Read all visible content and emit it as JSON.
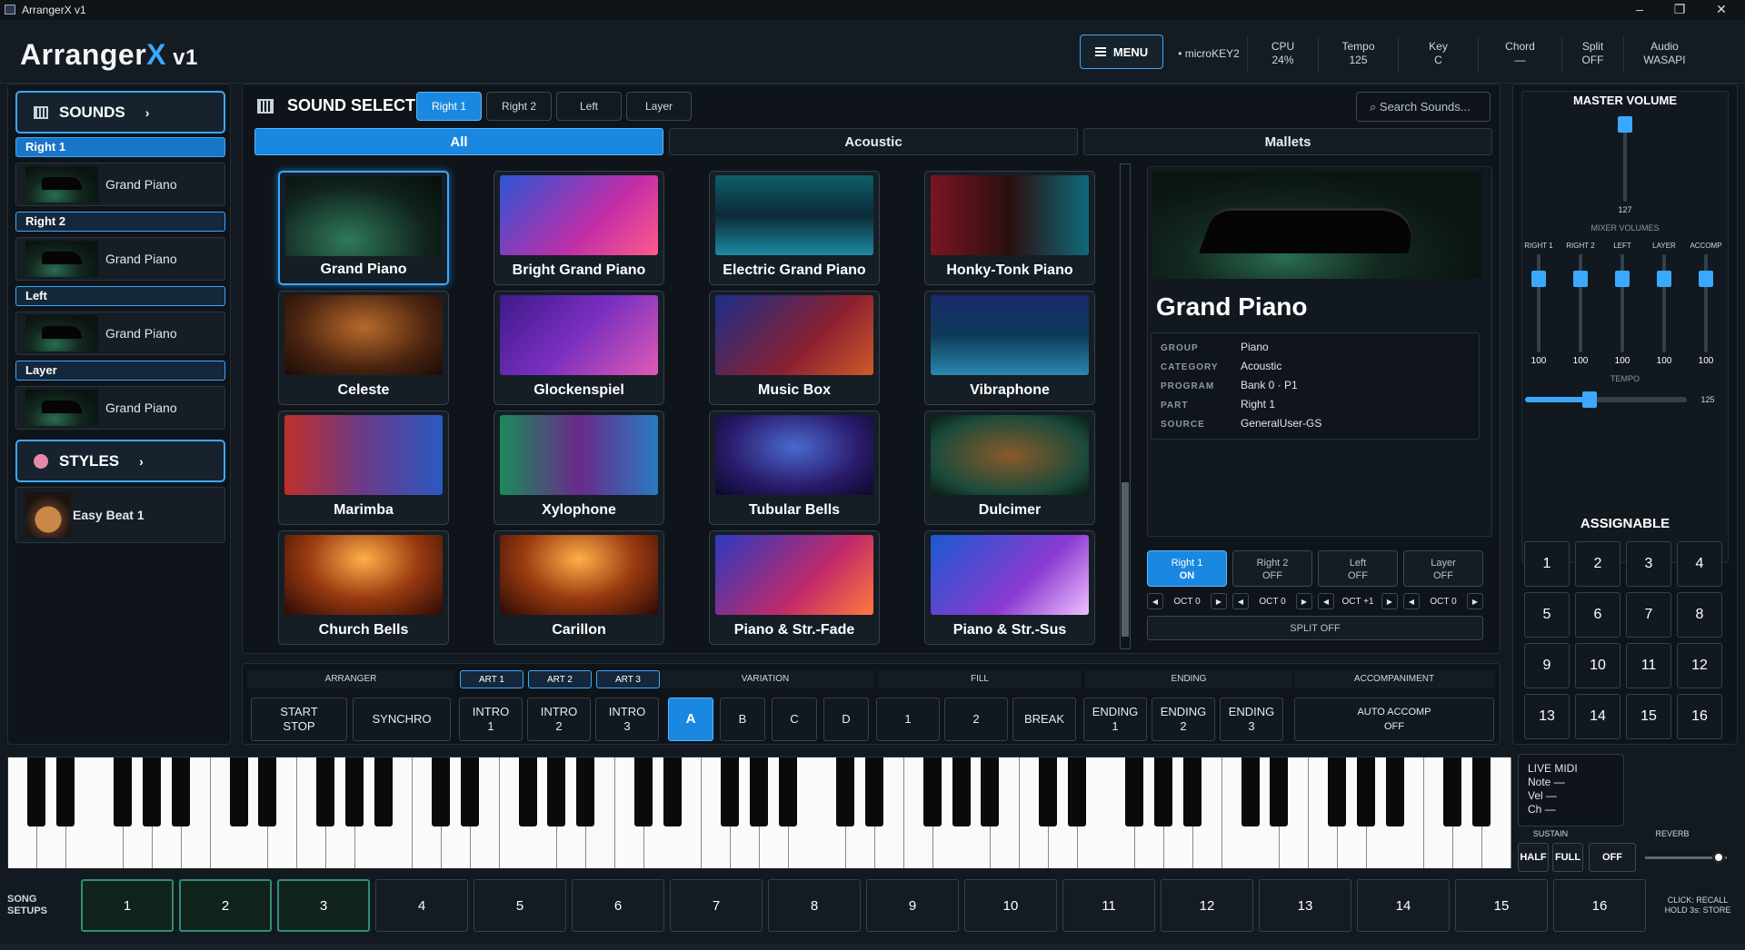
{
  "window": {
    "title": "ArrangerX v1",
    "minimize": "–",
    "maximize": "❐",
    "close": "✕"
  },
  "app": {
    "logo_main": "Arranger",
    "logo_x": "X",
    "logo_ver": " v1",
    "menu_label": "MENU"
  },
  "status": [
    {
      "top": "",
      "bottom": "• microKEY2"
    },
    {
      "top": "CPU",
      "bottom": "24%"
    },
    {
      "top": "Tempo",
      "bottom": "125"
    },
    {
      "top": "Key",
      "bottom": "C"
    },
    {
      "top": "Chord",
      "bottom": "—"
    },
    {
      "top": "Split",
      "bottom": "OFF"
    },
    {
      "top": "Audio",
      "bottom": "WASAPI"
    }
  ],
  "sidebar": {
    "sounds_label": "SOUNDS",
    "styles_label": "STYLES",
    "arrow": "›",
    "parts": [
      {
        "label": "Right 1",
        "sound": "Grand Piano"
      },
      {
        "label": "Right 2",
        "sound": "Grand Piano"
      },
      {
        "label": "Left",
        "sound": "Grand Piano"
      },
      {
        "label": "Layer",
        "sound": "Grand Piano"
      }
    ],
    "style": "Easy Beat 1"
  },
  "sound_select": {
    "title": "SOUND SELECT",
    "part_tabs": [
      "Right 1",
      "Right 2",
      "Left",
      "Layer"
    ],
    "search_placeholder": "⌕  Search Sounds...",
    "filters": [
      "All",
      "Acoustic",
      "Mallets"
    ],
    "tiles": [
      "Grand Piano",
      "Bright Grand Piano",
      "Electric Grand Piano",
      "Honky-Tonk Piano",
      "Celeste",
      "Glockenspiel",
      "Music Box",
      "Vibraphone",
      "Marimba",
      "Xylophone",
      "Tubular Bells",
      "Dulcimer",
      "Church Bells",
      "Carillon",
      "Piano & Str.-Fade",
      "Piano & Str.-Sus"
    ]
  },
  "detail": {
    "name": "Grand Piano",
    "rows": [
      {
        "k": "GROUP",
        "v": "Piano"
      },
      {
        "k": "CATEGORY",
        "v": "Acoustic"
      },
      {
        "k": "PROGRAM",
        "v": "Bank 0 · P1"
      },
      {
        "k": "PART",
        "v": "Right 1"
      },
      {
        "k": "SOURCE",
        "v": "GeneralUser-GS"
      }
    ],
    "parts": [
      {
        "name": "Right 1",
        "state": "ON",
        "oct": "OCT 0"
      },
      {
        "name": "Right 2",
        "state": "OFF",
        "oct": "OCT 0"
      },
      {
        "name": "Left",
        "state": "OFF",
        "oct": "OCT +1"
      },
      {
        "name": "Layer",
        "state": "OFF",
        "oct": "OCT 0"
      }
    ],
    "split": "SPLIT OFF"
  },
  "arranger": {
    "sections": [
      "ARRANGER",
      "VARIATION",
      "FILL",
      "ENDING",
      "ACCOMPANIMENT"
    ],
    "arts": [
      "ART 1",
      "ART 2",
      "ART 3"
    ],
    "start_stop": "START\nSTOP",
    "synchro": "SYNCHRO",
    "intros": [
      "INTRO\n1",
      "INTRO\n2",
      "INTRO\n3"
    ],
    "variations": [
      "A",
      "B",
      "C",
      "D"
    ],
    "fills": [
      "1",
      "2",
      "BREAK"
    ],
    "endings": [
      "ENDING\n1",
      "ENDING\n2",
      "ENDING\n3"
    ],
    "auto": "AUTO ACCOMP\nOFF"
  },
  "mixer": {
    "master_label": "MASTER VOLUME",
    "master_value": "127",
    "master_level": 127,
    "mixer_label": "MIXER VOLUMES",
    "channels": [
      {
        "name": "RIGHT 1",
        "value": "100"
      },
      {
        "name": "RIGHT 2",
        "value": "100"
      },
      {
        "name": "LEFT",
        "value": "100"
      },
      {
        "name": "LAYER",
        "value": "100"
      },
      {
        "name": "ACCOMP",
        "value": "100"
      }
    ],
    "tempo_label": "TEMPO",
    "tempo_value": "125",
    "tempo_fraction": 0.4
  },
  "assignable": {
    "label": "ASSIGNABLE",
    "buttons": [
      "1",
      "2",
      "3",
      "4",
      "5",
      "6",
      "7",
      "8",
      "9",
      "10",
      "11",
      "12",
      "13",
      "14",
      "15",
      "16"
    ]
  },
  "live_midi": {
    "title": "LIVE MIDI",
    "note": "Note  —",
    "vel": "Vel   —",
    "ch": "Ch    —"
  },
  "pedals": {
    "sustain_label": "SUSTAIN",
    "reverb_label": "REVERB",
    "half": "HALF",
    "full": "FULL",
    "off": "OFF",
    "reverb_fraction": 0.9
  },
  "setups": {
    "label": "SONG\nSETUPS",
    "buttons": [
      "1",
      "2",
      "3",
      "4",
      "5",
      "6",
      "7",
      "8",
      "9",
      "10",
      "11",
      "12",
      "13",
      "14",
      "15",
      "16"
    ],
    "used": [
      0,
      1,
      2
    ],
    "hint": "CLICK: RECALL\nHOLD 3s: STORE"
  },
  "colors": {
    "accent": "#3aa8ff",
    "selected": "#1a88e0",
    "setup_used": "#2f8f6e"
  }
}
